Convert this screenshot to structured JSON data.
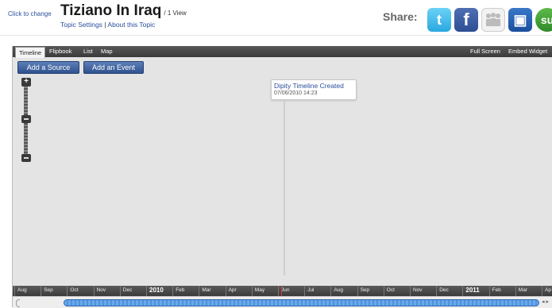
{
  "header": {
    "click_to_change": "Click to change",
    "title": "Tiziano In Iraq",
    "views": "/ 1 View",
    "topic_settings": "Topic Settings",
    "separator": "|",
    "about_topic": "About this Topic",
    "share_label": "Share:"
  },
  "share_icons": [
    "twitter-icon",
    "facebook-icon",
    "myspace-icon",
    "delicious-icon",
    "stumbleupon-icon"
  ],
  "tabs": {
    "timeline": "Timeline",
    "flipbook": "Flipbook",
    "list": "List",
    "map": "Map",
    "active": "Timeline"
  },
  "toolbar": {
    "full_screen": "Full Screen",
    "embed_widget": "Embed Widget",
    "add_source": "Add a Source",
    "add_event": "Add an Event"
  },
  "event": {
    "title": "Dipity Timeline Created",
    "date": "07/06/2010 14:23"
  },
  "axis_labels": [
    {
      "text": "Aug",
      "year": false
    },
    {
      "text": "Sep",
      "year": false
    },
    {
      "text": "Oct",
      "year": false
    },
    {
      "text": "Nov",
      "year": false
    },
    {
      "text": "Dec",
      "year": false
    },
    {
      "text": "2010",
      "year": true
    },
    {
      "text": "Feb",
      "year": false
    },
    {
      "text": "Mar",
      "year": false
    },
    {
      "text": "Apr",
      "year": false
    },
    {
      "text": "May",
      "year": false
    },
    {
      "text": "Jun",
      "year": false
    },
    {
      "text": "Jul",
      "year": false
    },
    {
      "text": "Aug",
      "year": false
    },
    {
      "text": "Sep",
      "year": false
    },
    {
      "text": "Oct",
      "year": false
    },
    {
      "text": "Nov",
      "year": false
    },
    {
      "text": "Dec",
      "year": false
    },
    {
      "text": "2011",
      "year": true
    },
    {
      "text": "Feb",
      "year": false
    },
    {
      "text": "Mar",
      "year": false
    },
    {
      "text": "Ap",
      "year": false
    }
  ],
  "scroll_arrows": "◂ ▸",
  "colors": {
    "link": "#2a4f9c",
    "button": "#2f528f",
    "current_marker": "#e03030"
  }
}
